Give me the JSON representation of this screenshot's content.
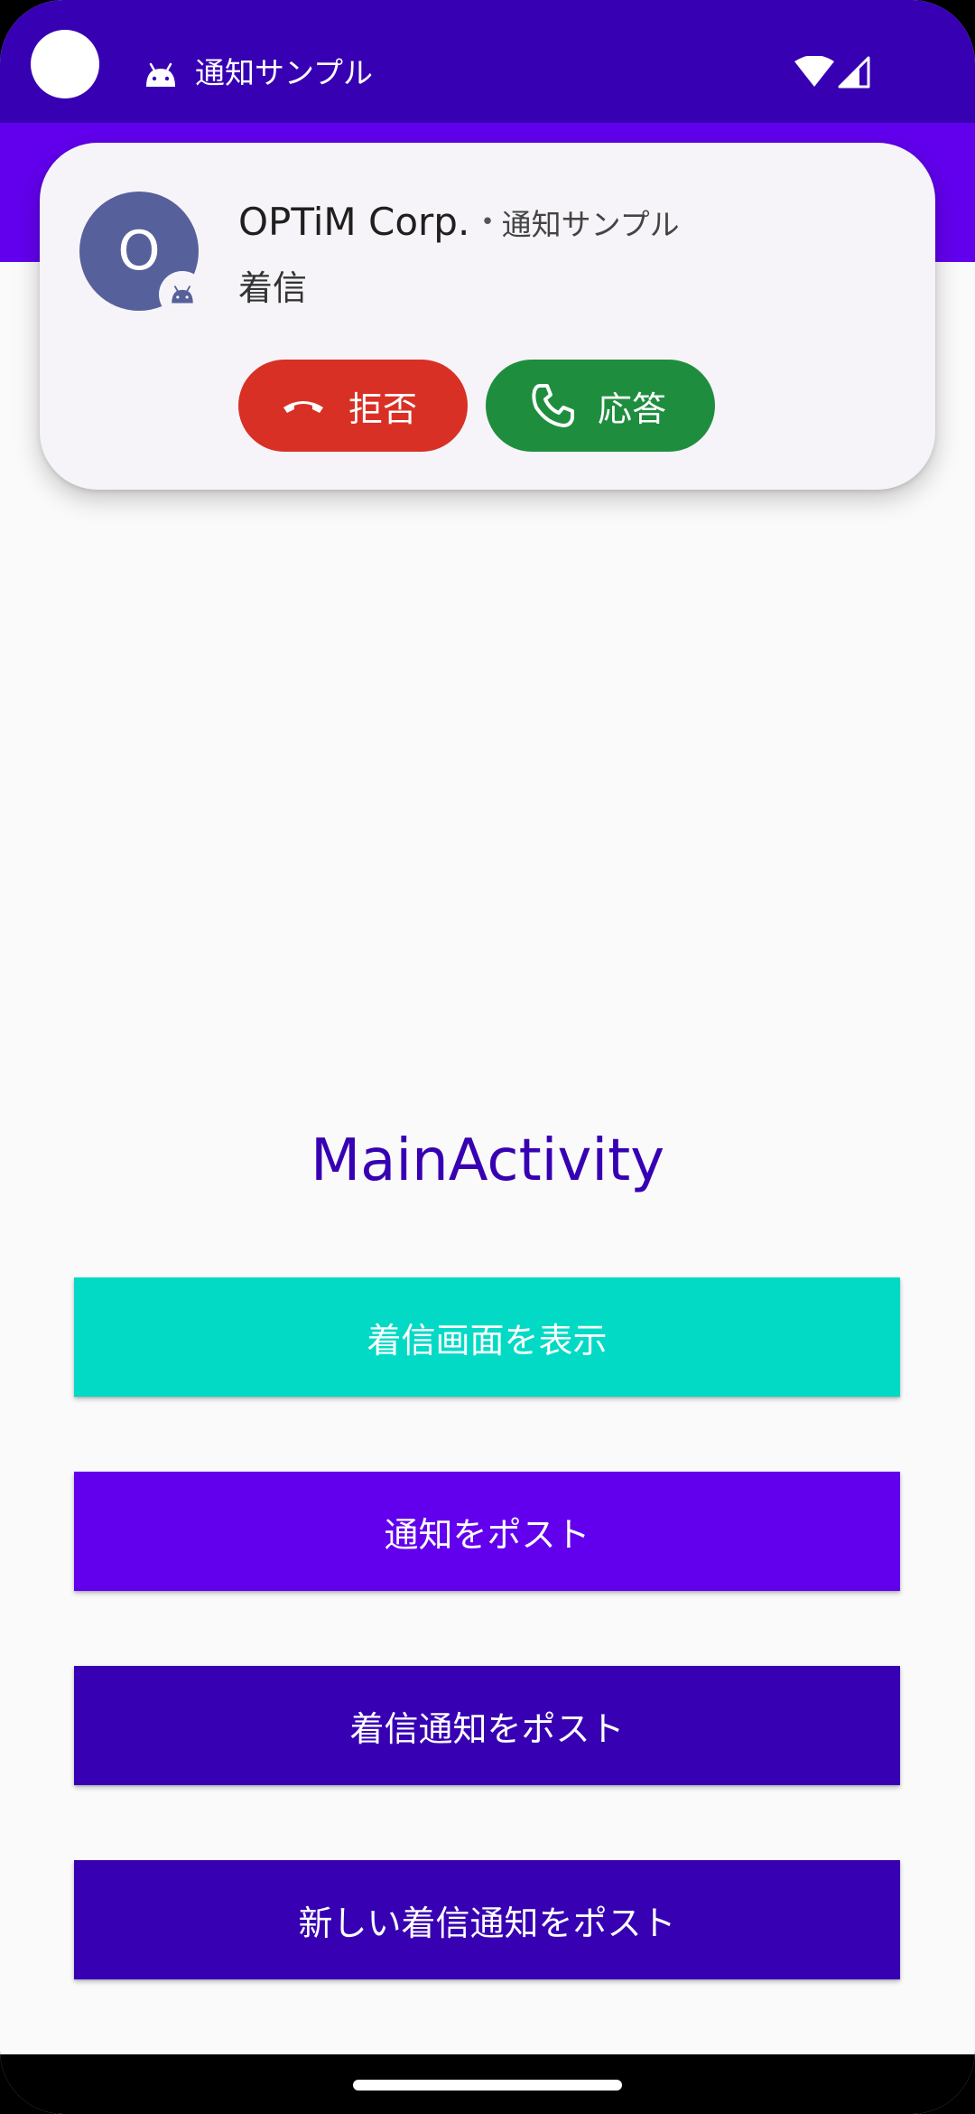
{
  "status_bar": {
    "app_name": "通知サンプル",
    "icons": [
      "android-icon",
      "wifi-icon",
      "signal-icon"
    ]
  },
  "notification": {
    "avatar_letter": "O",
    "caller": "OPTiM Corp.",
    "separator": "•",
    "app_name": "通知サンプル",
    "text": "着信",
    "decline_label": "拒否",
    "answer_label": "応答",
    "colors": {
      "decline": "#d93025",
      "answer": "#1e8e3e",
      "avatar": "#56609a"
    }
  },
  "main": {
    "title": "MainActivity",
    "buttons": [
      {
        "label": "着信画面を表示",
        "color": "#03dac5"
      },
      {
        "label": "通知をポスト",
        "color": "#6200ee"
      },
      {
        "label": "着信通知をポスト",
        "color": "#3700b3"
      },
      {
        "label": "新しい着信通知をポスト",
        "color": "#3700b3"
      }
    ]
  },
  "theme": {
    "primary": "#6200ee",
    "primary_dark": "#3700b3",
    "accent": "#03dac5"
  }
}
